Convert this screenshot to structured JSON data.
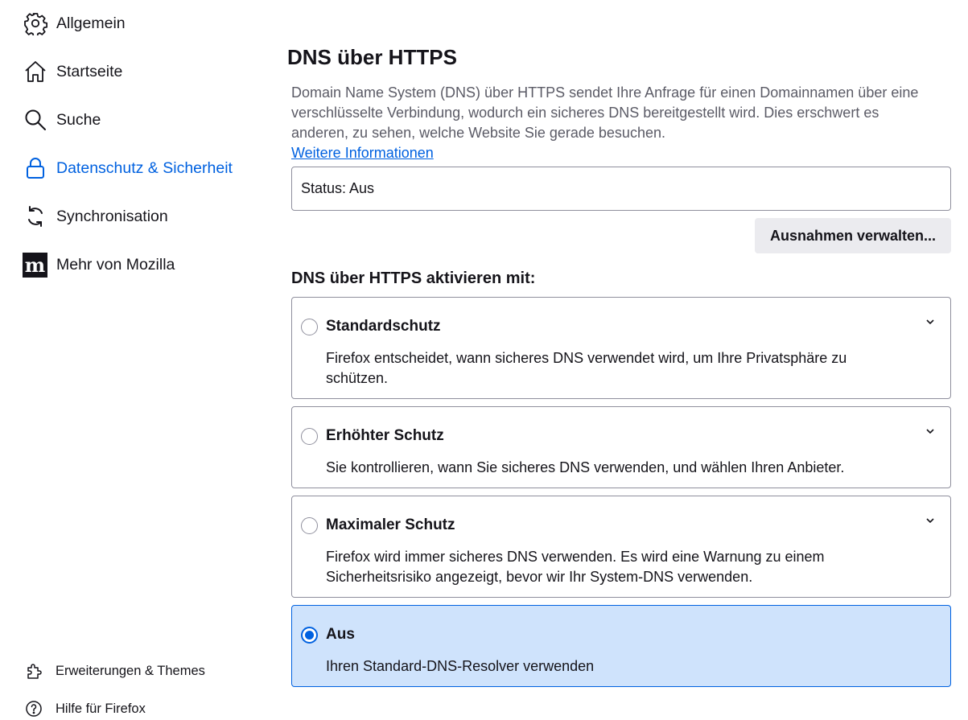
{
  "sidebar": {
    "items": [
      {
        "label": "Allgemein",
        "icon": "gear-icon"
      },
      {
        "label": "Startseite",
        "icon": "home-icon"
      },
      {
        "label": "Suche",
        "icon": "search-icon"
      },
      {
        "label": "Datenschutz & Sicherheit",
        "icon": "lock-icon",
        "selected": true
      },
      {
        "label": "Synchronisation",
        "icon": "sync-icon"
      },
      {
        "label": "Mehr von Mozilla",
        "icon": "mozilla-icon"
      }
    ],
    "footer": [
      {
        "label": "Erweiterungen & Themes",
        "icon": "puzzle-icon"
      },
      {
        "label": "Hilfe für Firefox",
        "icon": "help-icon"
      }
    ]
  },
  "main": {
    "title": "DNS über HTTPS",
    "description": "Domain Name System (DNS) über HTTPS sendet Ihre Anfrage für einen Domainnamen über eine verschlüsselte Verbindung, wodurch ein sicheres DNS bereitgestellt wird. Dies erschwert es anderen, zu sehen, welche Website Sie gerade besuchen.",
    "learn_more": "Weitere Informationen",
    "status": "Status: Aus",
    "exceptions_button": "Ausnahmen verwalten...",
    "group_label": "DNS über HTTPS aktivieren mit:",
    "options": [
      {
        "title": "Standardschutz",
        "description": "Firefox entscheidet, wann sicheres DNS verwendet wird, um Ihre Privatsphäre zu schützen.",
        "checked": false
      },
      {
        "title": "Erhöhter Schutz",
        "description": "Sie kontrollieren, wann Sie sicheres DNS verwenden, und wählen Ihren Anbieter.",
        "checked": false
      },
      {
        "title": "Maximaler Schutz",
        "description": "Firefox wird immer sicheres DNS verwenden. Es wird eine Warnung zu einem Sicherheitsrisiko angezeigt, bevor wir Ihr System-DNS verwenden.",
        "checked": false
      },
      {
        "title": "Aus",
        "description": "Ihren Standard-DNS-Resolver verwenden",
        "checked": true
      }
    ]
  },
  "colors": {
    "accent": "#0061e0",
    "selected_card": "#cfe3fc",
    "muted_text": "#5b5b66",
    "button_bg": "#ebebef"
  }
}
